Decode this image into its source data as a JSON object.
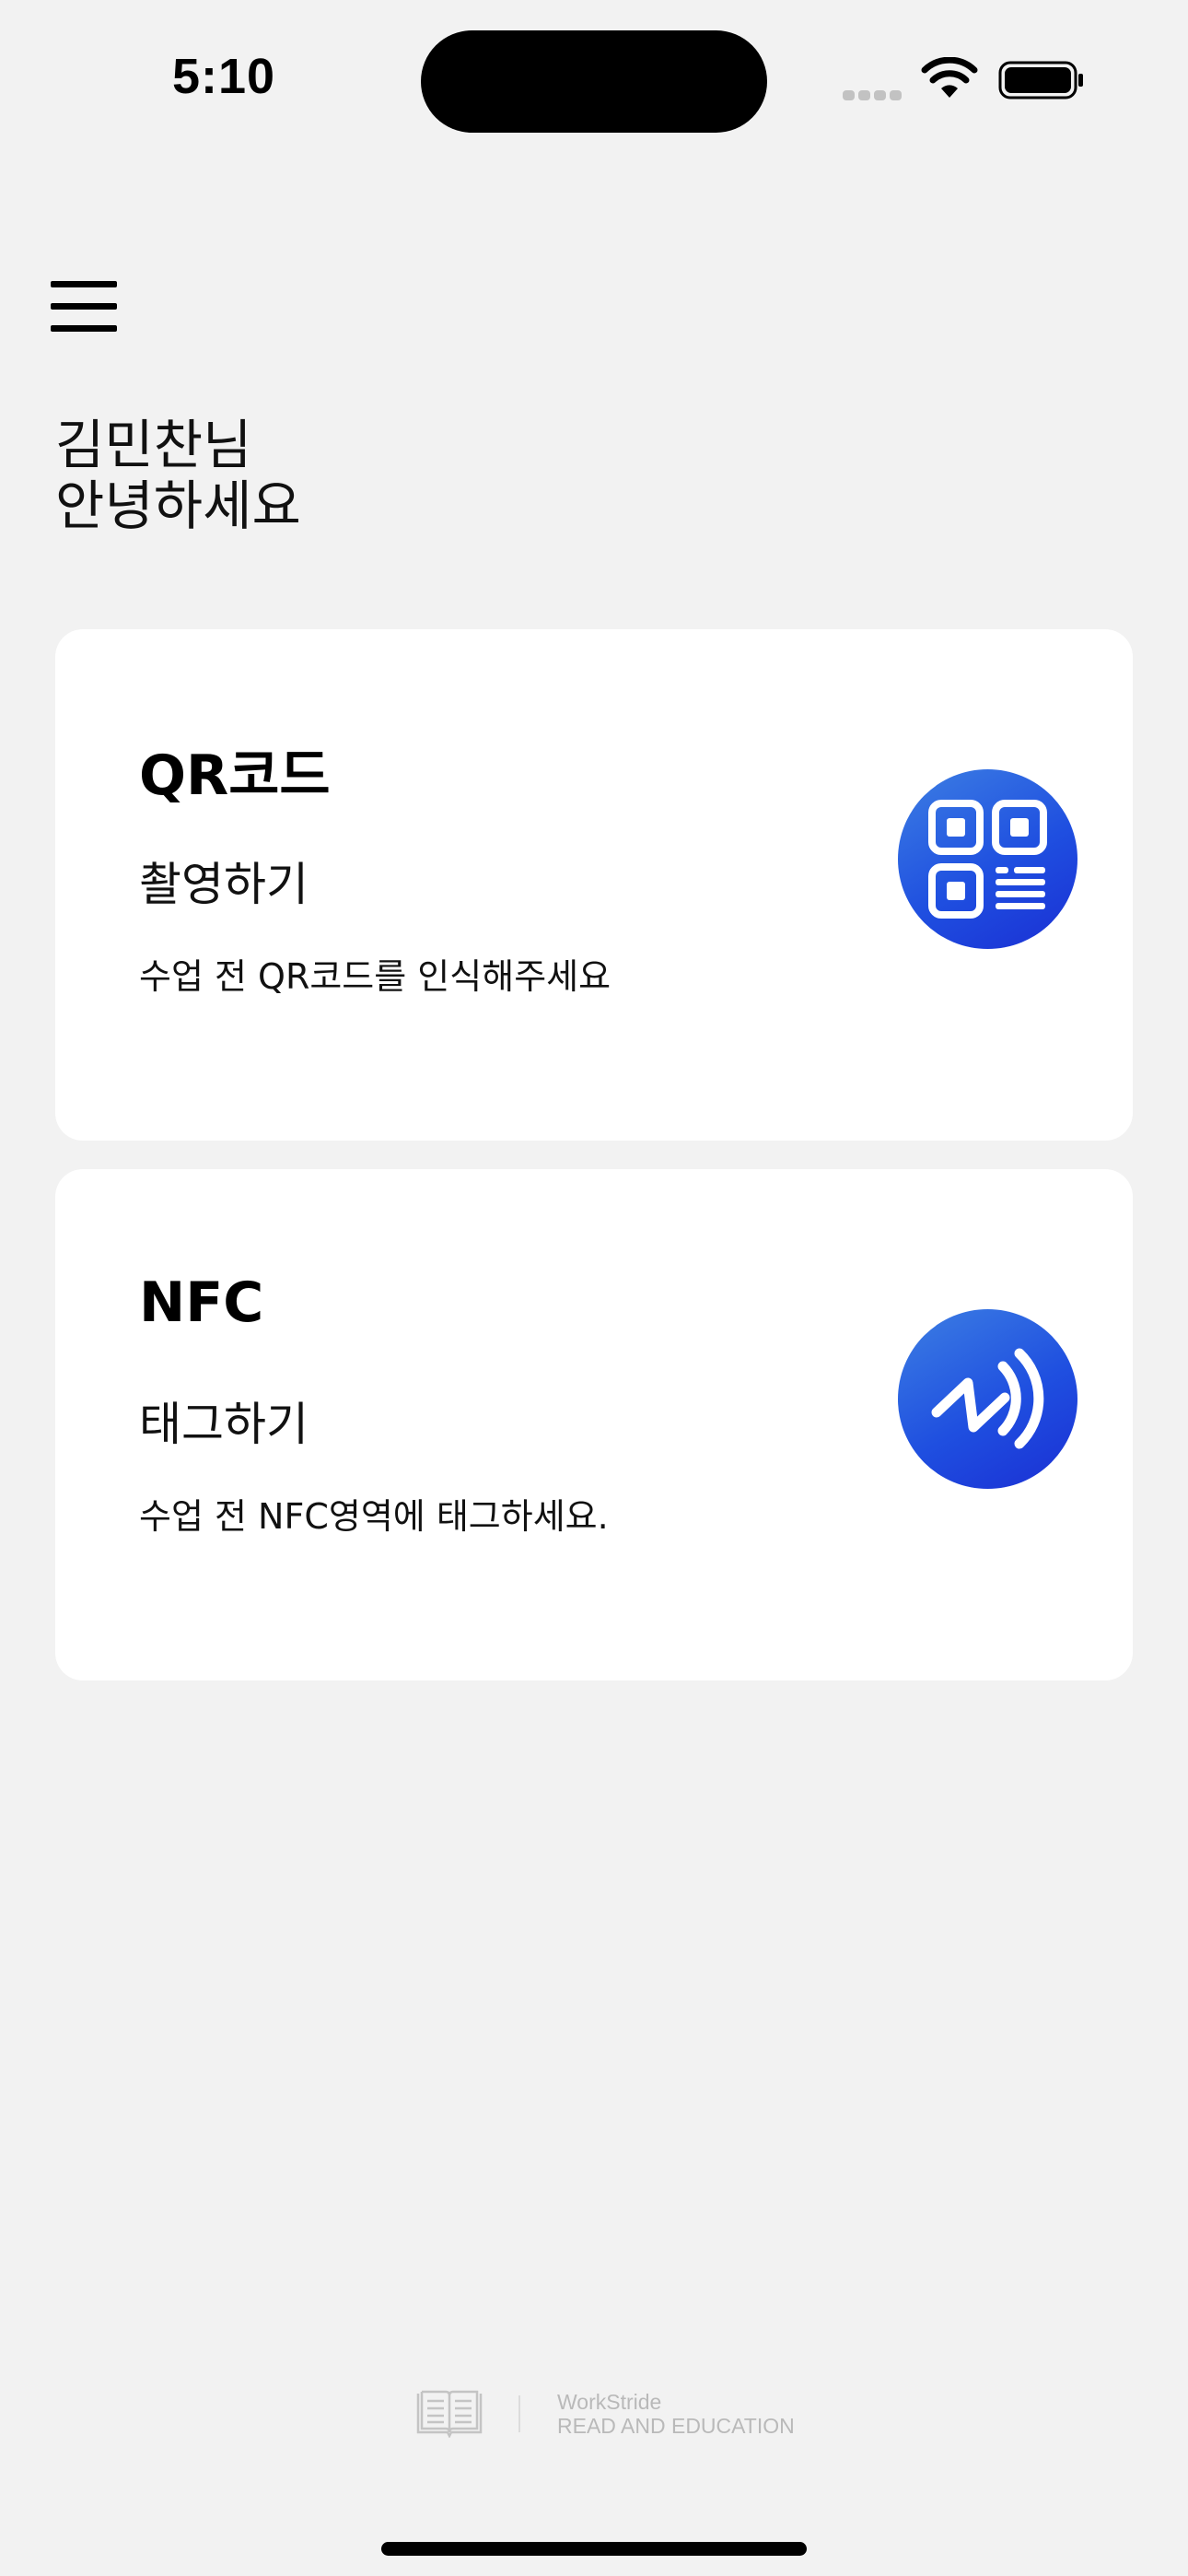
{
  "status_bar": {
    "time": "5:10"
  },
  "greeting": {
    "line1": "김민찬님",
    "line2": "안녕하세요"
  },
  "cards": [
    {
      "title": "QR코드",
      "subtitle": "촬영하기",
      "description": "수업 전 QR코드를 인식해주세요",
      "icon": "qr-code-icon"
    },
    {
      "title": "NFC",
      "subtitle": "태그하기",
      "description": "수업 전 NFC영역에 태그하세요.",
      "icon": "nfc-icon"
    }
  ],
  "footer": {
    "brand_line1": "WorkStride",
    "brand_line2": "READ AND EDUCATION",
    "icon": "book-icon"
  },
  "colors": {
    "background": "#f2f2f2",
    "card": "#ffffff",
    "accent_start": "#3d7fe3",
    "accent_end": "#1a2fd4"
  }
}
